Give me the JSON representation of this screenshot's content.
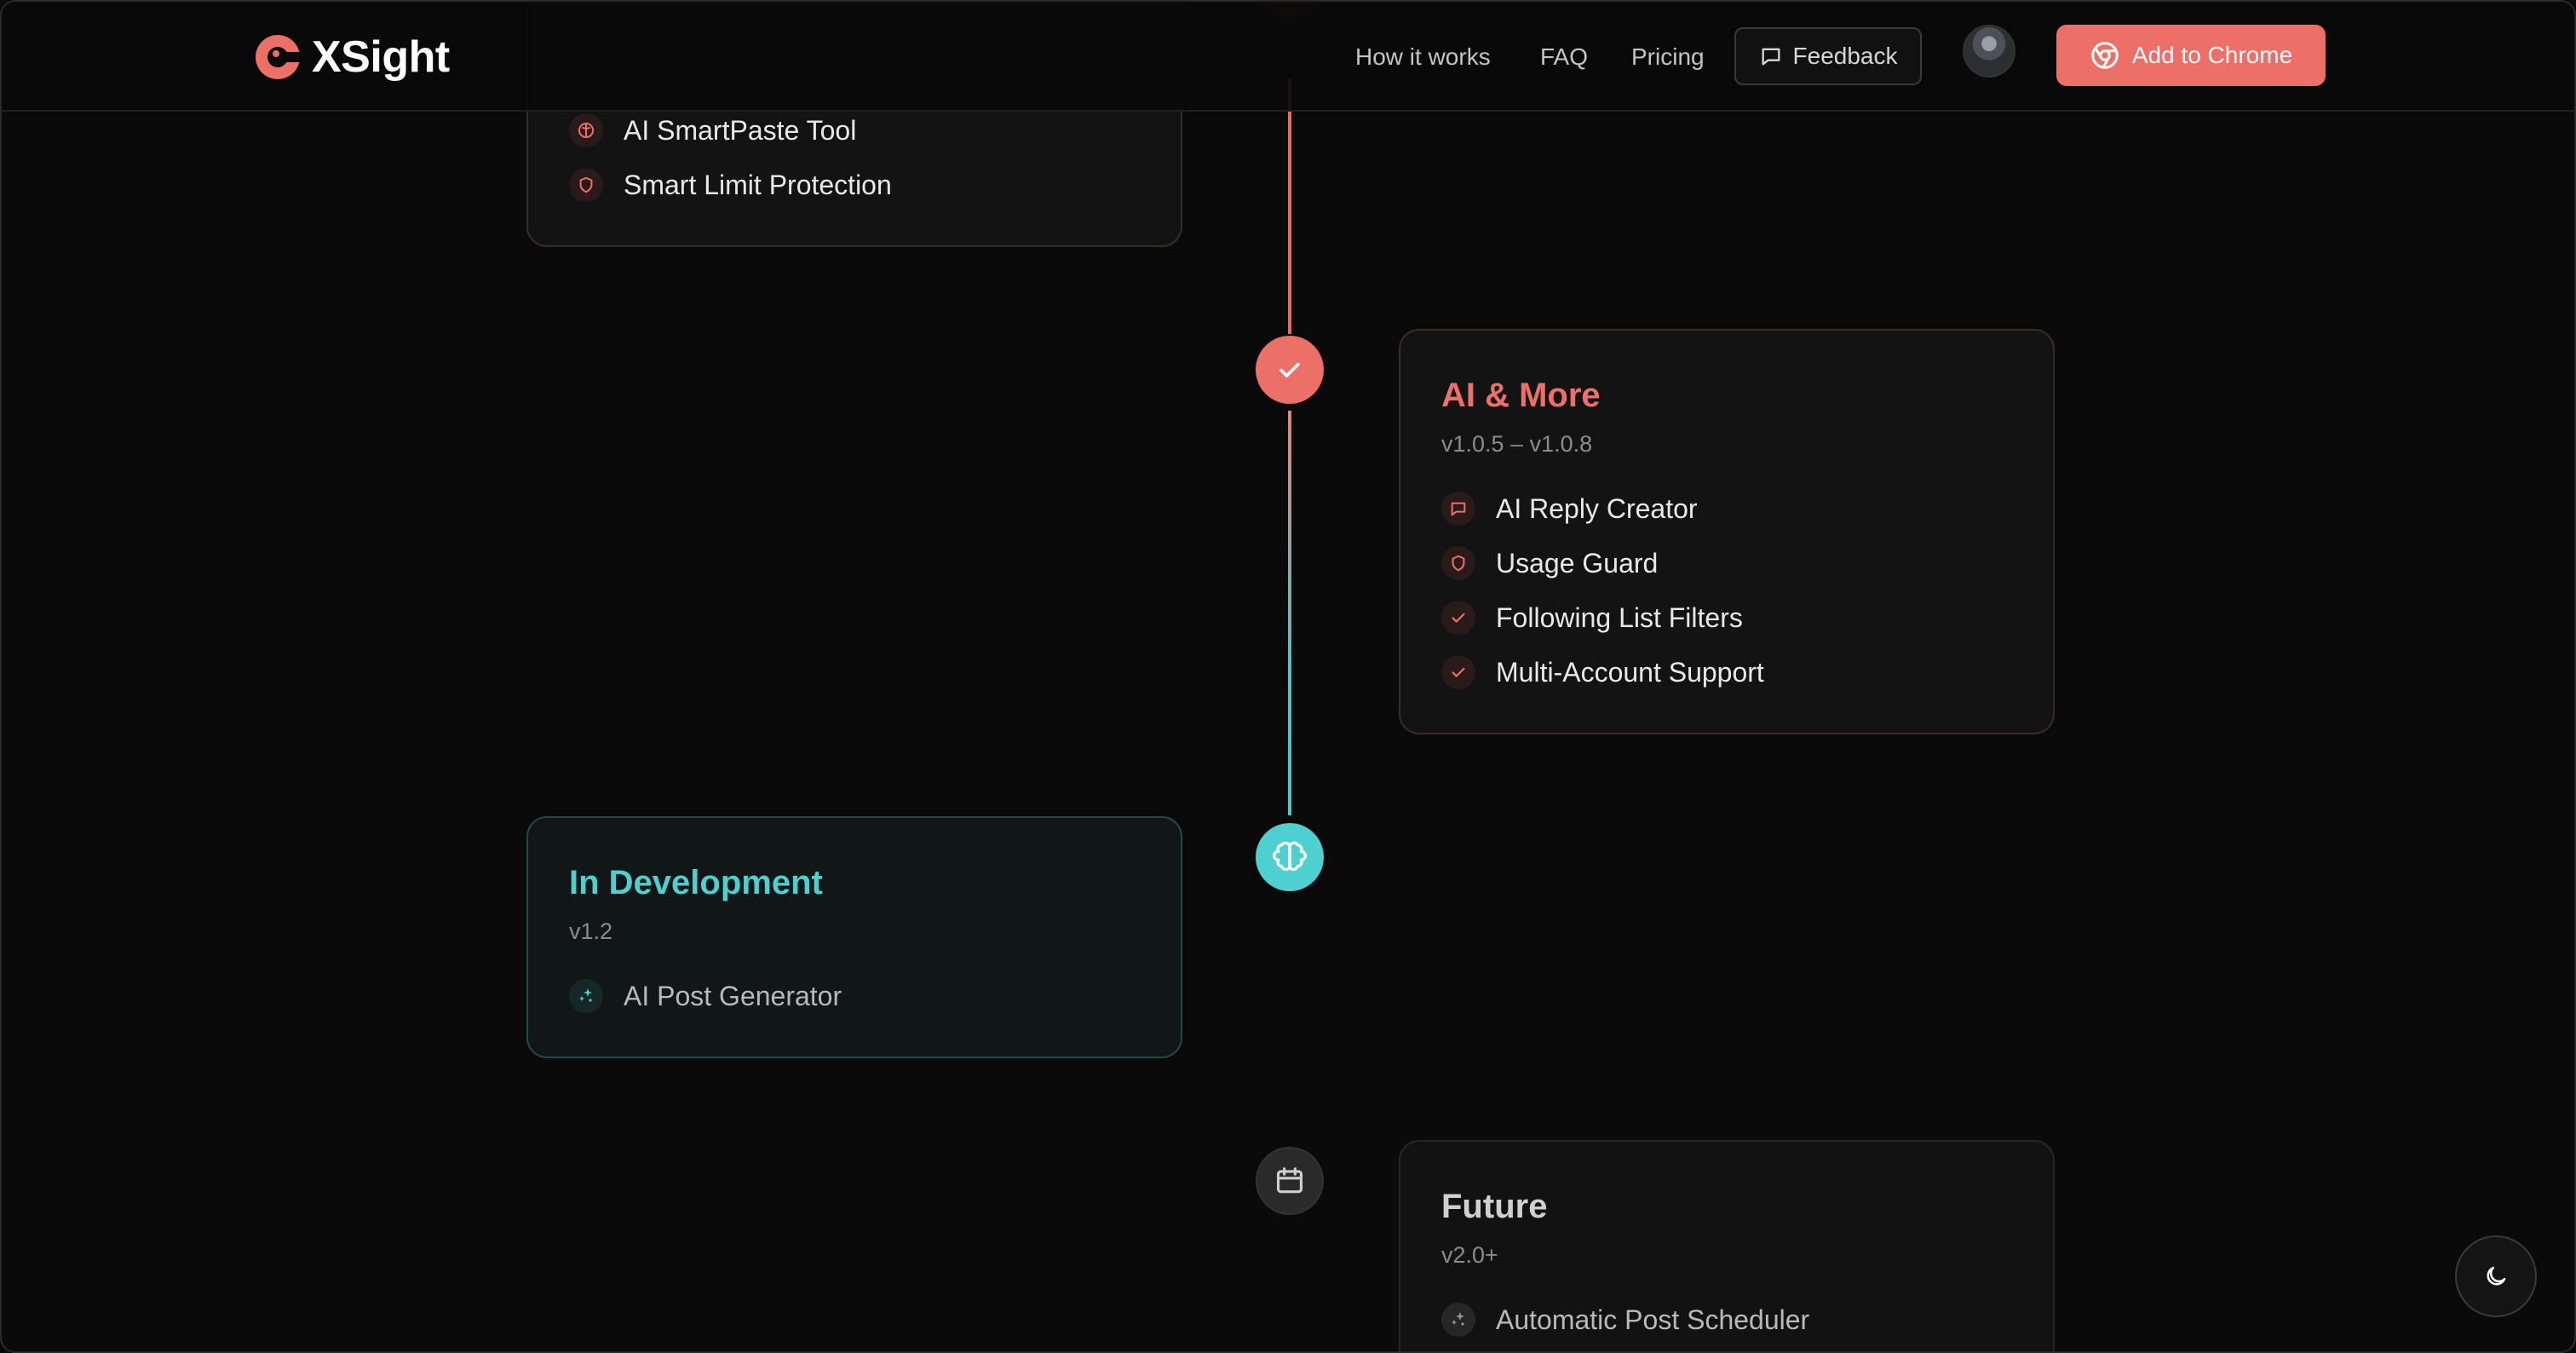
{
  "brand": {
    "name": "XSight",
    "accent": "#ec6f68",
    "teal": "#4ecfd0"
  },
  "nav": {
    "how_it_works": "How it works",
    "faq": "FAQ",
    "pricing": "Pricing",
    "feedback": "Feedback",
    "add_to_chrome": "Add to Chrome"
  },
  "timeline": {
    "top_card": {
      "features": [
        {
          "icon": "brain-icon",
          "label": "AI SmartPaste Tool"
        },
        {
          "icon": "shield-icon",
          "label": "Smart Limit Protection"
        }
      ]
    },
    "ai_more": {
      "title": "AI & More",
      "version": "v1.0.5 – v1.0.8",
      "features": [
        {
          "icon": "message-icon",
          "label": "AI Reply Creator"
        },
        {
          "icon": "shield-icon",
          "label": "Usage Guard"
        },
        {
          "icon": "check-icon",
          "label": "Following List Filters"
        },
        {
          "icon": "check-icon",
          "label": "Multi-Account Support"
        }
      ]
    },
    "in_development": {
      "title": "In Development",
      "version": "v1.2",
      "features": [
        {
          "icon": "sparkle-icon",
          "label": "AI Post Generator"
        }
      ]
    },
    "future": {
      "title": "Future",
      "version": "v2.0+",
      "features": [
        {
          "icon": "sparkle-icon",
          "label": "Automatic Post Scheduler"
        }
      ]
    }
  }
}
